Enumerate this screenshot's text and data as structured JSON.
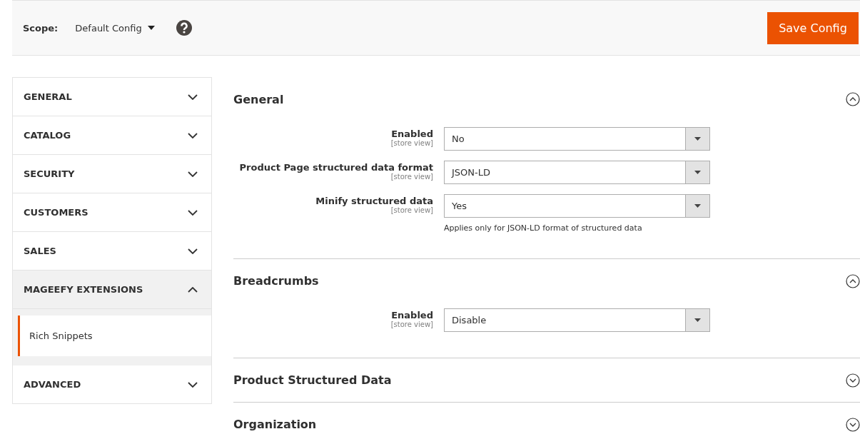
{
  "header": {
    "scope_label": "Scope:",
    "scope_value": "Default Config",
    "save_button": "Save Config"
  },
  "sidebar": {
    "items": [
      {
        "label": "GENERAL",
        "expanded": false
      },
      {
        "label": "CATALOG",
        "expanded": false
      },
      {
        "label": "SECURITY",
        "expanded": false
      },
      {
        "label": "CUSTOMERS",
        "expanded": false
      },
      {
        "label": "SALES",
        "expanded": false
      },
      {
        "label": "MAGEEFY EXTENSIONS",
        "expanded": true,
        "children": [
          {
            "label": "Rich Snippets",
            "selected": true
          }
        ]
      },
      {
        "label": "ADVANCED",
        "expanded": false
      }
    ]
  },
  "sections": [
    {
      "title": "General",
      "expanded": true,
      "fields": [
        {
          "label": "Enabled",
          "scope": "[store view]",
          "value": "No"
        },
        {
          "label": "Product Page structured data format",
          "scope": "[store view]",
          "value": "JSON-LD"
        },
        {
          "label": "Minify structured data",
          "scope": "[store view]",
          "value": "Yes",
          "note": "Applies only for JSON-LD format of structured data"
        }
      ]
    },
    {
      "title": "Breadcrumbs",
      "expanded": true,
      "fields": [
        {
          "label": "Enabled",
          "scope": "[store view]",
          "value": "Disable"
        }
      ]
    },
    {
      "title": "Product Structured Data",
      "expanded": false
    },
    {
      "title": "Organization",
      "expanded": false
    }
  ]
}
